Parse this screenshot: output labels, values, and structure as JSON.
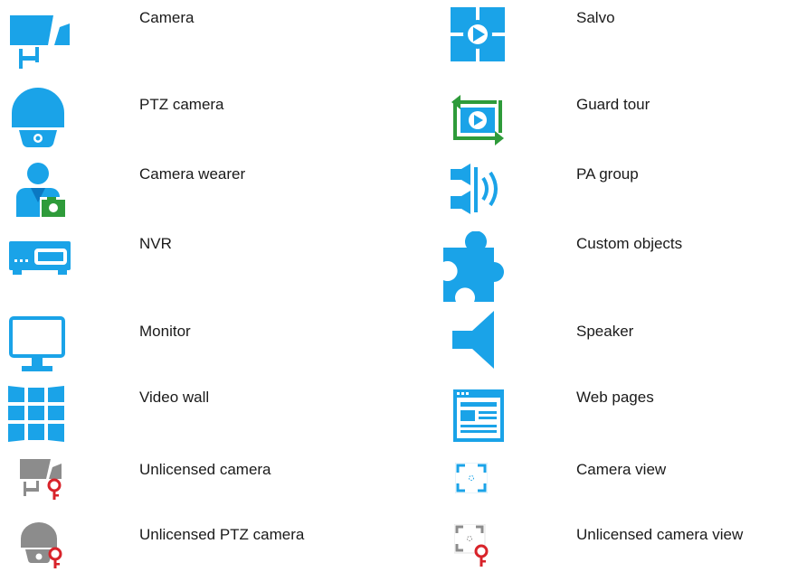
{
  "legend": {
    "left": [
      {
        "label": "Camera",
        "icon": "camera-icon"
      },
      {
        "label": "PTZ camera",
        "icon": "ptz-camera-icon"
      },
      {
        "label": "Camera wearer",
        "icon": "camera-wearer-icon"
      },
      {
        "label": "NVR",
        "icon": "nvr-icon"
      },
      {
        "label": "Monitor",
        "icon": "monitor-icon"
      },
      {
        "label": "Video wall",
        "icon": "video-wall-icon"
      },
      {
        "label": "Unlicensed camera",
        "icon": "unlicensed-camera-icon"
      },
      {
        "label": "Unlicensed PTZ camera",
        "icon": "unlicensed-ptz-camera-icon"
      }
    ],
    "right": [
      {
        "label": "Salvo",
        "icon": "salvo-icon"
      },
      {
        "label": "Guard tour",
        "icon": "guard-tour-icon"
      },
      {
        "label": "PA group",
        "icon": "pa-group-icon"
      },
      {
        "label": "Custom objects",
        "icon": "custom-objects-icon"
      },
      {
        "label": "Speaker",
        "icon": "speaker-icon"
      },
      {
        "label": "Web pages",
        "icon": "web-pages-icon"
      },
      {
        "label": "Camera view",
        "icon": "camera-view-icon"
      },
      {
        "label": "Unlicensed camera view",
        "icon": "unlicensed-camera-view-icon"
      }
    ]
  },
  "colors": {
    "icon_blue": "#1aa3e8",
    "icon_dark_blue": "#0b78c2",
    "icon_green": "#2e9b3a",
    "icon_gray": "#8c8c8c",
    "key_red": "#d8232a",
    "text": "#1a1a1a"
  }
}
